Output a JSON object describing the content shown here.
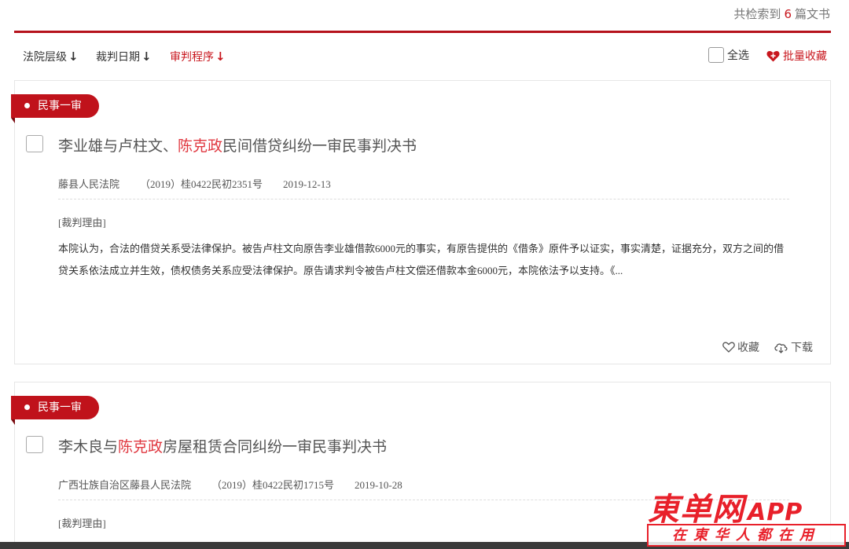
{
  "header": {
    "count_prefix": "共检索到",
    "count": "6",
    "count_suffix": "篇文书"
  },
  "sort": {
    "court_level": "法院层级",
    "judge_date": "裁判日期",
    "procedure": "审判程序",
    "arrow": "↓",
    "select_all": "全选",
    "batch_favorite": "批量收藏"
  },
  "results": [
    {
      "tag": "民事一审",
      "title_before": "李业雄与卢柱文、",
      "title_highlight": "陈克政",
      "title_after": "民间借贷纠纷一审民事判决书",
      "court": "藤县人民法院",
      "case_no": "（2019）桂0422民初2351号",
      "date": "2019-12-13",
      "reason_label": "[裁判理由]",
      "reason": "本院认为，合法的借贷关系受法律保护。被告卢柱文向原告李业雄借款6000元的事实，有原告提供的《借条》原件予以证实，事实清楚，证据充分，双方之间的借贷关系依法成立并生效，债权债务关系应受法律保护。原告请求判令被告卢柱文偿还借款本金6000元，本院依法予以支持。《...",
      "favorite": "收藏",
      "download": "下载"
    },
    {
      "tag": "民事一审",
      "title_before": "李木良与",
      "title_highlight": "陈克政",
      "title_after": "房屋租赁合同纠纷一审民事判决书",
      "court": "广西壮族自治区藤县人民法院",
      "case_no": "（2019）桂0422民初1715号",
      "date": "2019-10-28",
      "reason_label": "[裁判理由]"
    }
  ],
  "watermark": {
    "brand": "東单网",
    "app": "APP",
    "slogan": "在東华人都在用"
  },
  "colors": {
    "accent": "#c8161d",
    "tag_bg": "#c0121b",
    "highlight": "#e0373f"
  }
}
